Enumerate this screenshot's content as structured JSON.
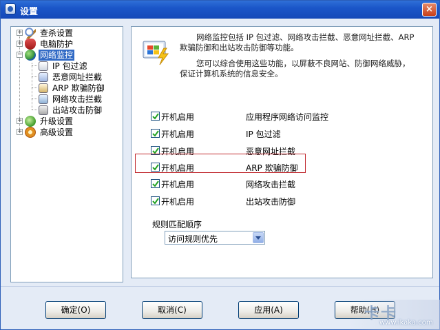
{
  "window": {
    "title": "设置",
    "close_glyph": "×"
  },
  "tree": {
    "items": [
      {
        "label": "查杀设置",
        "icon": "magnifier-icon"
      },
      {
        "label": "电脑防护",
        "icon": "shield-icon"
      },
      {
        "label": "网络监控",
        "icon": "globe-network-icon"
      },
      {
        "label": "IP 包过滤",
        "icon": "ip-filter-icon"
      },
      {
        "label": "恶意网址拦截",
        "icon": "url-block-icon"
      },
      {
        "label": "ARP 欺骗防御",
        "icon": "arp-defense-icon"
      },
      {
        "label": "网络攻击拦截",
        "icon": "attack-block-icon"
      },
      {
        "label": "出站攻击防御",
        "icon": "outbound-defense-icon"
      },
      {
        "label": "升级设置",
        "icon": "update-icon"
      },
      {
        "label": "高级设置",
        "icon": "advanced-gear-icon"
      }
    ],
    "expander_plus": "+",
    "expander_minus": "−"
  },
  "content": {
    "description_line1": "网络监控包括 IP 包过滤、网络攻击拦截、恶意网址拦截、ARP",
    "description_line2": "欺骗防御和出站攻击防御等功能。",
    "description_line3": "您可以综合使用这些功能，以屏蔽不良网站、防御网络威胁，",
    "description_line4": "保证计算机系统的信息安全。",
    "options": [
      {
        "label": "开机启用",
        "desc": "应用程序网络访问监控",
        "checked": true
      },
      {
        "label": "开机启用",
        "desc": "IP 包过滤",
        "checked": true
      },
      {
        "label": "开机启用",
        "desc": "恶意网址拦截",
        "checked": true
      },
      {
        "label": "开机启用",
        "desc": "ARP 欺骗防御",
        "checked": true
      },
      {
        "label": "开机启用",
        "desc": "网络攻击拦截",
        "checked": true
      },
      {
        "label": "开机启用",
        "desc": "出站攻击防御",
        "checked": true
      }
    ],
    "order_label": "规则匹配顺序",
    "order_value": "访问规则优先"
  },
  "buttons": {
    "ok": "确定(O)",
    "cancel": "取消(C)",
    "apply": "应用(A)",
    "help": "帮助(H)"
  },
  "watermark": {
    "logo": "卡卡",
    "url": "www.ikaka.com"
  },
  "colors": {
    "selected_bg": "#316ac5",
    "highlight_border": "#c0282d",
    "title_bar": "#1b56c8"
  }
}
